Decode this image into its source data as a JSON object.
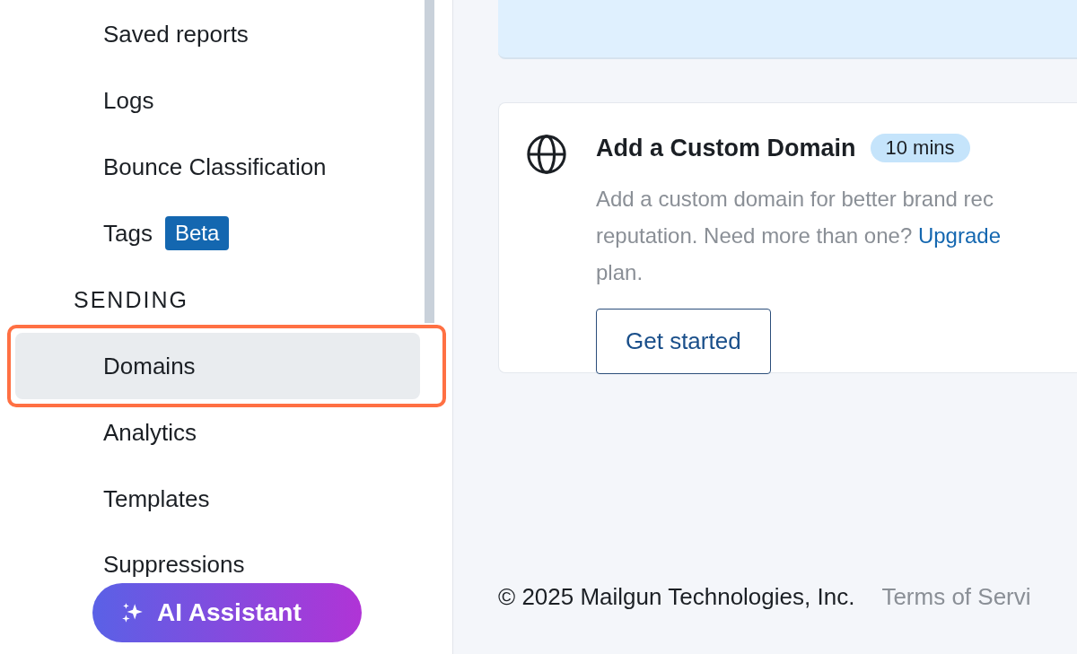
{
  "sidebar": {
    "items": [
      {
        "kind": "item",
        "label": "Saved reports",
        "selected": false
      },
      {
        "kind": "item",
        "label": "Logs",
        "selected": false
      },
      {
        "kind": "item",
        "label": "Bounce Classification",
        "selected": false
      },
      {
        "kind": "item",
        "label": "Tags",
        "badge": "Beta",
        "selected": false
      },
      {
        "kind": "section",
        "label": "SENDING"
      },
      {
        "kind": "item",
        "label": "Domains",
        "selected": true,
        "highlighted": true
      },
      {
        "kind": "item",
        "label": "Analytics",
        "selected": false
      },
      {
        "kind": "item",
        "label": "Templates",
        "selected": false
      },
      {
        "kind": "item",
        "label": "Suppressions",
        "selected": false
      }
    ],
    "assistant_button": "AI Assistant"
  },
  "card": {
    "title": "Add a Custom Domain",
    "badge": "10 mins",
    "description": [
      {
        "text": "Add a custom domain for better brand rec"
      },
      {
        "text": "reputation. Need more than one? ",
        "link": "Upgrade"
      },
      {
        "text": "plan."
      }
    ],
    "button": "Get started"
  },
  "footer": {
    "copyright": "© 2025 Mailgun Technologies, Inc.",
    "link": "Terms of Servi"
  }
}
